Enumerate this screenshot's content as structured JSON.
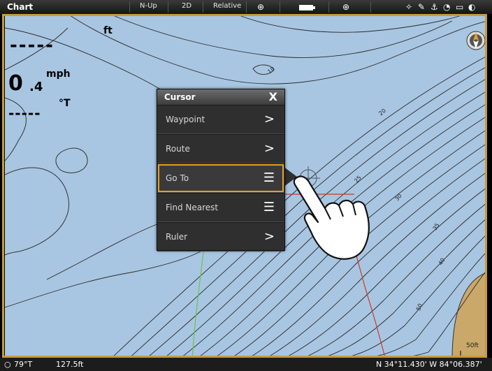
{
  "header": {
    "title": "Chart",
    "orientation": "N-Up",
    "view_mode": "2D",
    "motion_mode": "Relative",
    "icons": [
      "globe-icon",
      "battery-icon",
      "crosshair-icon",
      "fish-icon",
      "satellite-icon",
      "compass-icon",
      "alarm-icon"
    ]
  },
  "readouts": {
    "depth_value": "-----",
    "depth_unit": "ft",
    "speed_int": "0",
    "speed_dec": ".4",
    "speed_unit": "mph",
    "heading_value": "-----",
    "heading_unit": "°T"
  },
  "cursor_menu": {
    "title": "Cursor",
    "close_label": "X",
    "items": [
      {
        "label": "Waypoint",
        "indicator": ">"
      },
      {
        "label": "Route",
        "indicator": ">"
      },
      {
        "label": "Go To",
        "indicator": "☰"
      },
      {
        "label": "Find Nearest",
        "indicator": "☰"
      },
      {
        "label": "Ruler",
        "indicator": ">"
      }
    ],
    "selected": "Go To"
  },
  "map": {
    "scale_label": "50ft",
    "depth_labels": [
      "10",
      "20",
      "25",
      "30",
      "35",
      "40",
      "50"
    ]
  },
  "status": {
    "water_temp": "79°T",
    "depth": "127.5ft",
    "position": "N 34°11.430' W 84°06.387'"
  },
  "colors": {
    "water": "#a8c6e2",
    "land": "#c9a86a",
    "border": "#c89a3c",
    "selection": "#e3a126"
  }
}
